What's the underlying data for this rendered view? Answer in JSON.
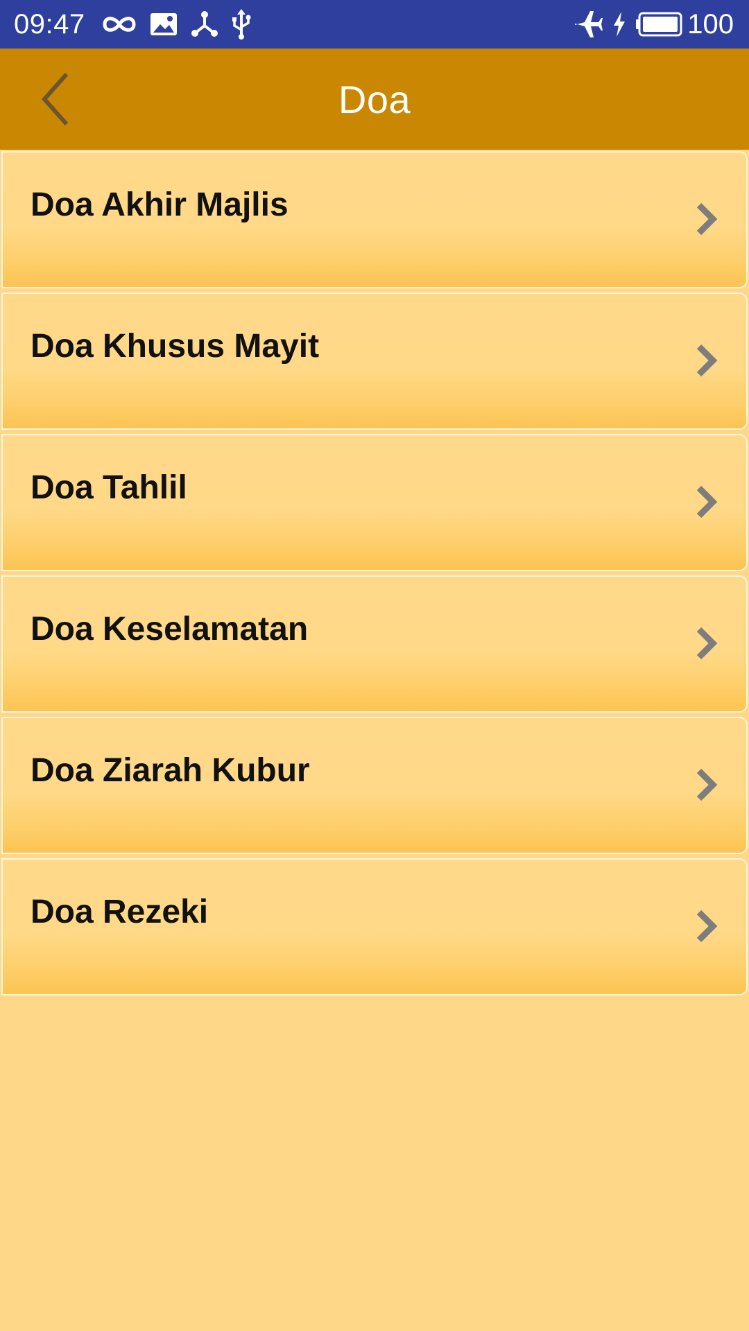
{
  "status_bar": {
    "time": "09:47",
    "left_icons": [
      "infinity-icon",
      "image-icon",
      "share-network-icon",
      "usb-icon"
    ],
    "right_icons": [
      "airplane-icon",
      "charging-bolt-icon",
      "battery-icon"
    ],
    "battery_level": "100"
  },
  "app_bar": {
    "title": "Doa",
    "back_icon": "chevron-left-icon"
  },
  "list": {
    "items": [
      {
        "label": "Doa Akhir Majlis"
      },
      {
        "label": "Doa Khusus Mayit"
      },
      {
        "label": "Doa Tahlil"
      },
      {
        "label": "Doa Keselamatan"
      },
      {
        "label": "Doa Ziarah Kubur"
      },
      {
        "label": "Doa Rezeki"
      }
    ]
  },
  "colors": {
    "status_bar": "#2e3f9e",
    "app_bar": "#c98702",
    "background": "#ffd789"
  }
}
